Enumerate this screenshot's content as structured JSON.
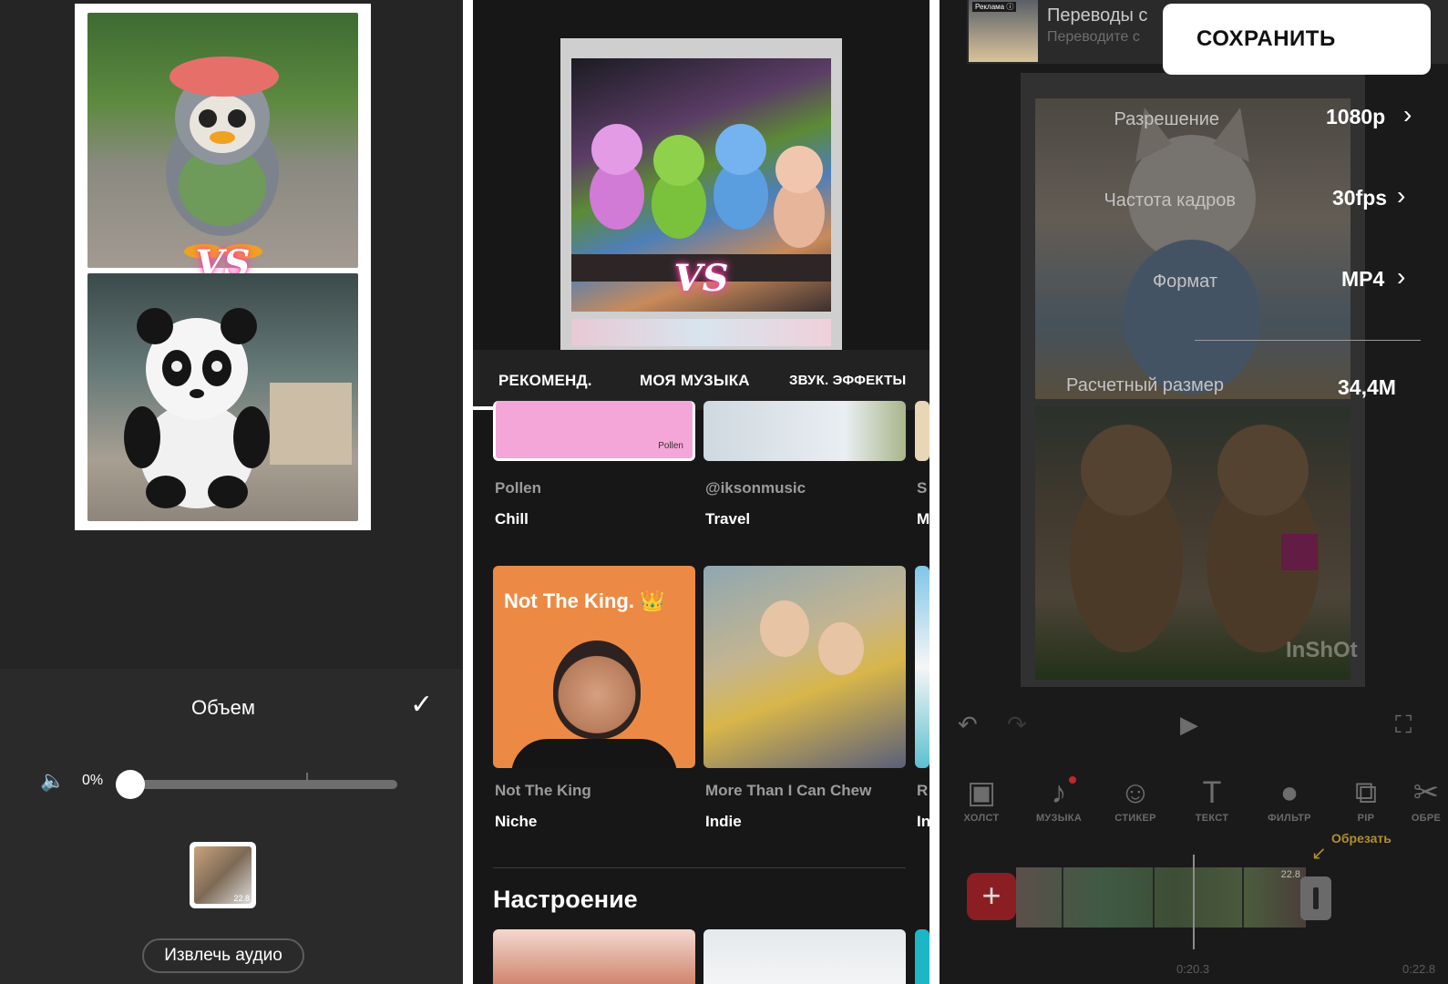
{
  "panel1": {
    "vs_text": "VS",
    "volume_title": "Объем",
    "volume_percent": "0%",
    "volume_value": 0,
    "thumb_duration": "22.8",
    "extract_audio": "Извлечь аудио",
    "icons": {
      "confirm": "check-icon",
      "speaker": "speaker-icon"
    }
  },
  "panel2": {
    "vs_text": "VS",
    "tabs": [
      {
        "label": "РЕКОМЕНД.",
        "active": true
      },
      {
        "label": "МОЯ МУЗЫКА",
        "active": false
      },
      {
        "label": "ЗВУК. ЭФФЕКТЫ",
        "active": false
      }
    ],
    "row1": [
      {
        "card_text": "Pollen",
        "artist": "Pollen",
        "genre": "Chill"
      },
      {
        "card_text": "",
        "artist": "@iksonmusic",
        "genre": "Travel"
      },
      {
        "artist": "S",
        "genre": "M"
      }
    ],
    "row2": [
      {
        "card_text": "Not The King. 👑",
        "artist": "Not The King",
        "genre": "Niche"
      },
      {
        "card_text": "",
        "artist": "More Than I Can Chew",
        "genre": "Indie"
      },
      {
        "artist": "R",
        "genre": "In"
      }
    ],
    "section_title": "Настроение"
  },
  "panel3": {
    "ad": {
      "badge": "Реклама ⓘ",
      "title": "Переводы с",
      "subtitle": "Переводите с"
    },
    "save_label": "СОХРАНИТЬ",
    "settings": [
      {
        "label": "Разрешение",
        "value": "1080p"
      },
      {
        "label": "Частота кадров",
        "value": "30fps"
      },
      {
        "label": "Формат",
        "value": "MP4"
      },
      {
        "label": "Расчетный размер",
        "value": "34,4M"
      }
    ],
    "watermark": "InShOt",
    "toolbar": [
      {
        "label": "ХОЛСТ",
        "icon": "canvas-icon"
      },
      {
        "label": "МУЗЫКА",
        "icon": "music-icon"
      },
      {
        "label": "СТИКЕР",
        "icon": "sticker-icon"
      },
      {
        "label": "ТЕКСТ",
        "icon": "text-icon"
      },
      {
        "label": "ФИЛЬТР",
        "icon": "filter-icon"
      },
      {
        "label": "PIP",
        "icon": "pip-icon"
      },
      {
        "label": "ОБРЕ",
        "icon": "scissors-icon"
      }
    ],
    "trim_hint": "Обрезать",
    "clip_duration": "22.8",
    "time_current": "0:20.3",
    "time_total": "0:22.8",
    "accent_color": "#c3262c"
  }
}
